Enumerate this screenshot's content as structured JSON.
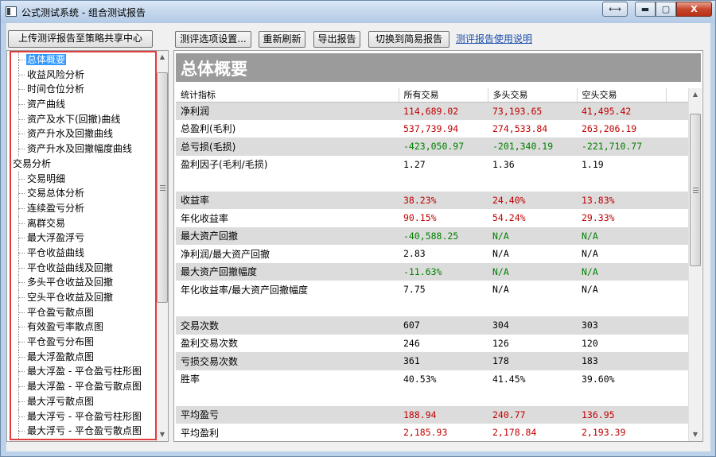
{
  "window": {
    "title": "公式测试系统 - 组合测试报告",
    "restore_glyph": "⟷",
    "minimize_glyph": "▬",
    "maximize_glyph": "▢",
    "close_glyph": "X"
  },
  "toolbar": {
    "upload_label": "上传测评报告至策略共享中心",
    "settings_label": "测评选项设置...",
    "refresh_label": "重新刷新",
    "export_label": "导出报告",
    "switch_label": "切换到简易报告",
    "help_link": "测评报告使用说明"
  },
  "tree": {
    "items": [
      {
        "label": "总体概要",
        "level": 1,
        "selected": true
      },
      {
        "label": "收益风险分析",
        "level": 1
      },
      {
        "label": "时间仓位分析",
        "level": 1
      },
      {
        "label": "资产曲线",
        "level": 1
      },
      {
        "label": "资产及水下(回撤)曲线",
        "level": 1
      },
      {
        "label": "资产升水及回撤曲线",
        "level": 1
      },
      {
        "label": "资产升水及回撤幅度曲线",
        "level": 1
      },
      {
        "label": "交易分析",
        "level": 0
      },
      {
        "label": "交易明细",
        "level": 1
      },
      {
        "label": "交易总体分析",
        "level": 1
      },
      {
        "label": "连续盈亏分析",
        "level": 1
      },
      {
        "label": "离群交易",
        "level": 1
      },
      {
        "label": "最大浮盈浮亏",
        "level": 1
      },
      {
        "label": "平仓收益曲线",
        "level": 1
      },
      {
        "label": "平仓收益曲线及回撤",
        "level": 1
      },
      {
        "label": "多头平仓收益及回撤",
        "level": 1
      },
      {
        "label": "空头平仓收益及回撤",
        "level": 1
      },
      {
        "label": "平仓盈亏散点图",
        "level": 1
      },
      {
        "label": "有效盈亏率散点图",
        "level": 1
      },
      {
        "label": "平仓盈亏分布图",
        "level": 1
      },
      {
        "label": "最大浮盈散点图",
        "level": 1
      },
      {
        "label": "最大浮盈 - 平仓盈亏柱形图",
        "level": 1
      },
      {
        "label": "最大浮盈 - 平仓盈亏散点图",
        "level": 1
      },
      {
        "label": "最大浮亏散点图",
        "level": 1
      },
      {
        "label": "最大浮亏 - 平仓盈亏柱形图",
        "level": 1
      },
      {
        "label": "最大浮亏 - 平仓盈亏散点图",
        "level": 1
      }
    ]
  },
  "report": {
    "section_title": "总体概要",
    "columns": [
      "统计指标",
      "所有交易",
      "多头交易",
      "空头交易"
    ],
    "rows": [
      {
        "label": "净利润",
        "all": "114,689.02",
        "long": "73,193.65",
        "short": "41,495.42",
        "color": "red"
      },
      {
        "label": "总盈利(毛利)",
        "all": "537,739.94",
        "long": "274,533.84",
        "short": "263,206.19",
        "color": "red"
      },
      {
        "label": "总亏损(毛损)",
        "all": "-423,050.97",
        "long": "-201,340.19",
        "short": "-221,710.77",
        "color": "green"
      },
      {
        "label": "盈利因子(毛利/毛损)",
        "all": "1.27",
        "long": "1.36",
        "short": "1.19",
        "color": ""
      },
      {
        "label": "",
        "all": "",
        "long": "",
        "short": "",
        "color": ""
      },
      {
        "label": "收益率",
        "all": "38.23%",
        "long": "24.40%",
        "short": "13.83%",
        "color": "red"
      },
      {
        "label": "年化收益率",
        "all": "90.15%",
        "long": "54.24%",
        "short": "29.33%",
        "color": "red"
      },
      {
        "label": "最大资产回撤",
        "all": "-40,588.25",
        "long": "N/A",
        "short": "N/A",
        "color": "green"
      },
      {
        "label": "净利润/最大资产回撤",
        "all": "2.83",
        "long": "N/A",
        "short": "N/A",
        "color": ""
      },
      {
        "label": "最大资产回撤幅度",
        "all": "-11.63%",
        "long": "N/A",
        "short": "N/A",
        "color": "green"
      },
      {
        "label": "年化收益率/最大资产回撤幅度",
        "all": "7.75",
        "long": "N/A",
        "short": "N/A",
        "color": ""
      },
      {
        "label": "",
        "all": "",
        "long": "",
        "short": "",
        "color": ""
      },
      {
        "label": "交易次数",
        "all": "607",
        "long": "304",
        "short": "303",
        "color": ""
      },
      {
        "label": "盈利交易次数",
        "all": "246",
        "long": "126",
        "short": "120",
        "color": ""
      },
      {
        "label": "亏损交易次数",
        "all": "361",
        "long": "178",
        "short": "183",
        "color": ""
      },
      {
        "label": "胜率",
        "all": "40.53%",
        "long": "41.45%",
        "short": "39.60%",
        "color": ""
      },
      {
        "label": "",
        "all": "",
        "long": "",
        "short": "",
        "color": ""
      },
      {
        "label": "平均盈亏",
        "all": "188.94",
        "long": "240.77",
        "short": "136.95",
        "color": "red"
      },
      {
        "label": "平均盈利",
        "all": "2,185.93",
        "long": "2,178.84",
        "short": "2,193.39",
        "color": "red"
      }
    ]
  },
  "colors": {
    "positive": "#c00000",
    "negative": "#008000",
    "header_band": "#9b9b9b",
    "selection": "#3399ff",
    "highlight_box": "#e23b3b"
  },
  "icons": {
    "scroll_up": "▲",
    "scroll_down": "▼"
  }
}
